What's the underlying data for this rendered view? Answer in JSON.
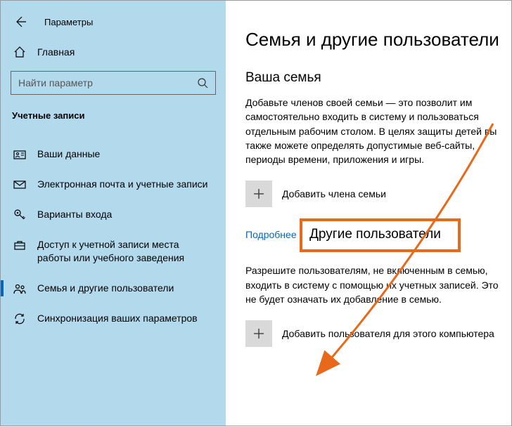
{
  "header": {
    "title": "Параметры"
  },
  "sidebar": {
    "home_label": "Главная",
    "search_placeholder": "Найти параметр",
    "section_title": "Учетные записи",
    "items": [
      {
        "label": "Ваши данные"
      },
      {
        "label": "Электронная почта и учетные записи"
      },
      {
        "label": "Варианты входа"
      },
      {
        "label": "Доступ к учетной записи места работы или учебного заведения"
      },
      {
        "label": "Семья и другие пользователи"
      },
      {
        "label": "Синхронизация ваших параметров"
      }
    ]
  },
  "content": {
    "page_title": "Семья и другие пользователи",
    "family": {
      "heading": "Ваша семья",
      "text": "Добавьте членов своей семьи — это позволит им самостоятельно входить в систему и пользоваться отдельным рабочим столом. В целях защиты детей вы также можете определять допустимые веб-сайты, периоды времени, приложения и игры.",
      "add_label": "Добавить члена семьи",
      "more_link": "Подробнее"
    },
    "others": {
      "heading": "Другие пользователи",
      "text": "Разрешите пользователям, не включенным в семью, входить в систему с помощью их учетных записей. Это не будет означать их добавление в семью.",
      "add_label": "Добавить пользователя для этого компьютера"
    }
  }
}
